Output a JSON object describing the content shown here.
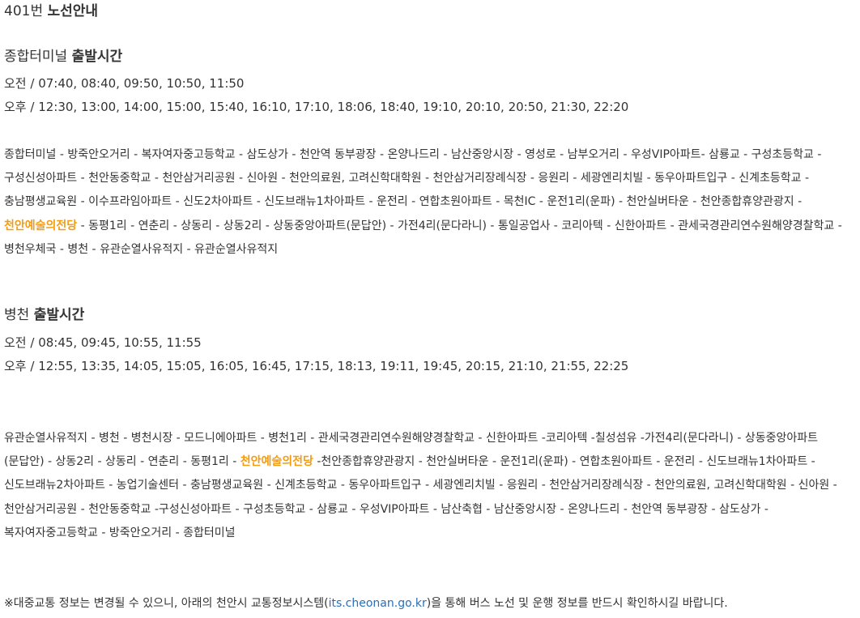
{
  "route_number": "401번",
  "route_title_bold": "노선안내",
  "sections": [
    {
      "heading_place": "종합터미널",
      "heading_bold": "출발시간",
      "am": "오전 / 07:40, 08:40, 09:50, 10:50, 11:50",
      "pm": "오후 / 12:30, 13:00, 14:00, 15:00, 15:40, 16:10, 17:10, 18:06, 18:40, 19:10, 20:10, 20:50, 21:30, 22:20",
      "route_before": "종합터미널 - 방죽안오거리 - 복자여자중고등학교 - 삼도상가 - 천안역 동부광장 - 온양나드리 - 남산중앙시장 - 영성로 - 남부오거리 - 우성VIP아파트- 삼룡교 - 구성초등학교 - 구성신성아파트 - 천안동중학교 - 천안삼거리공원 - 신아원 - 천안의료원, 고려신학대학원 - 천안삼거리장례식장 - 응원리 - 세광엔리치빌 - 동우아파트입구 - 신계초등학교 - 충남평생교육원 - 이수프라임아파트 - 신도2차아파트 - 신도브래뉴1차아파트 - 운전리 - 연합초원아파트 - 목천IC - 운전1리(운파) - 천안실버타운 - 천안종합휴양관광지 - ",
      "route_highlight": "천안예술의전당",
      "route_after": " - 동평1리 - 연춘리 - 상동리 - 상동2리 - 상동중앙아파트(문답안) - 가전4리(문다라니) - 통일공업사 - 코리아텍 - 신한아파트 - 관세국경관리연수원해양경찰학교 - 병천우체국 - 병천 - 유관순열사유적지 - 유관순열사유적지"
    },
    {
      "heading_place": "병천",
      "heading_bold": "출발시간",
      "am": "오전 / 08:45, 09:45, 10:55, 11:55",
      "pm": "오후 / 12:55, 13:35, 14:05, 15:05, 16:05, 16:45, 17:15, 18:13, 19:11, 19:45, 20:15, 21:10, 21:55, 22:25",
      "route_before": "유관순열사유적지 - 병천 - 병천시장 - 모드니에아파트 - 병천1리 - 관세국경관리연수원해양경찰학교 - 신한아파트 -코리아텍 -칠성섬유 -가전4리(문다라니) - 상동중앙아파트(문답안) - 상동2리 - 상동리 - 연춘리 - 동평1리 - ",
      "route_highlight": "천안예술의전당",
      "route_after": " -천안종합휴양관광지 - 천안실버타운 - 운전1리(운파) - 연합초원아파트 - 운전리 - 신도브래뉴1차아파트 -신도브래뉴2차아파트 - 농업기술센터 - 충남평생교육원 - 신계초등학교 - 동우아파트입구 - 세광엔리치빌 - 응원리 - 천안삼거리장례식장 - 천안의료원, 고려신학대학원 - 신아원 -천안삼거리공원 - 천안동중학교 -구성신성아파트 - 구성초등학교 - 삼룡교 - 우성VIP아파트 - 남산축협 - 남산중앙시장 - 온양나드리 - 천안역 동부광장 - 삼도상가 - 복자여자중고등학교 - 방죽안오거리 - 종합터미널"
    }
  ],
  "notice": {
    "before": "※대중교통 정보는 변경될 수 있으니, 아래의 천안시 교통정보시스템(",
    "link": "its.cheonan.go.kr",
    "after": ")을 통해 버스 노선 및 운행 정보를 반드시 확인하시길 바랍니다."
  },
  "colors": {
    "highlight": "#f39c12",
    "link": "#2a6fb5",
    "text": "#333333"
  }
}
